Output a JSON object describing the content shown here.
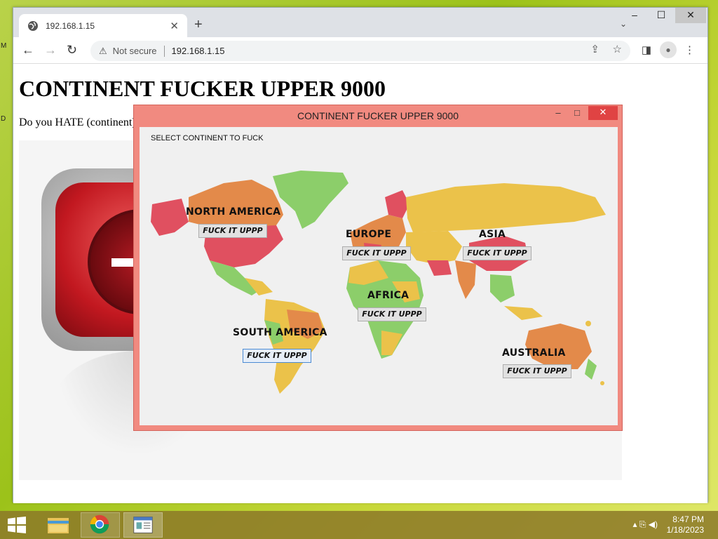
{
  "desktop": {
    "edge_a": "M",
    "edge_b": "D"
  },
  "browser": {
    "tab": {
      "title": "192.168.1.15",
      "close": "✕"
    },
    "new_tab": "+",
    "tab_menu": "⌄",
    "window": {
      "min": "–",
      "max": "☐",
      "close": "✕"
    },
    "nav": {
      "back": "←",
      "forward": "→",
      "reload": "↻"
    },
    "omnibox": {
      "warning_icon": "⚠",
      "security": "Not secure",
      "url": "192.168.1.15"
    },
    "actions": {
      "share": "⇪",
      "bookmark": "☆",
      "sidepanel": "◨",
      "menu": "⋮"
    }
  },
  "page": {
    "heading": "CONTINENT FUCKER UPPER 9000",
    "paragraph": "Do you HATE (continent)"
  },
  "app": {
    "title": "CONTINENT FUCKER UPPER 9000",
    "window": {
      "min": "–",
      "max": "□",
      "close": "✕"
    },
    "prompt": "SELECT CONTINENT TO FUCK",
    "continents": [
      {
        "name": "NORTH AMERICA",
        "button": "FUCK IT UPPP"
      },
      {
        "name": "EUROPE",
        "button": "FUCK IT UPPP"
      },
      {
        "name": "ASIA",
        "button": "FUCK IT UPPP"
      },
      {
        "name": "AFRICA",
        "button": "FUCK IT UPPP"
      },
      {
        "name": "SOUTH AMERICA",
        "button": "FUCK IT UPPP"
      },
      {
        "name": "AUSTRALIA",
        "button": "FUCK IT UPPP"
      }
    ],
    "colors": {
      "frame": "#f18a80",
      "close": "#e04343",
      "red": "#e05060",
      "orange": "#e38a4a",
      "yellow": "#ebc24a",
      "green": "#8cce6a"
    }
  },
  "taskbar": {
    "tray": "▴ ⎘ ◀)",
    "time": "8:47 PM",
    "date": "1/18/2023"
  }
}
